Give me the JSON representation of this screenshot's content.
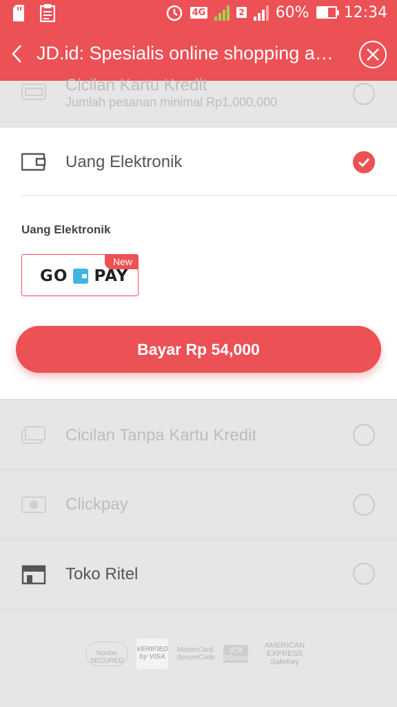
{
  "status_bar": {
    "network": "4G",
    "sim_slot": "2",
    "battery_percent": "60%",
    "battery_level": 0.6,
    "time": "12:34",
    "icons": [
      "sd-card-icon",
      "clipboard-icon",
      "alarm-icon",
      "signal-icon",
      "battery-icon"
    ]
  },
  "app_bar": {
    "title": "JD.id: Spesialis online shopping a…",
    "back_icon": "back-arrow-icon",
    "close_icon": "close-icon"
  },
  "colors": {
    "accent": "#ec5156",
    "gopay_blue": "#3fb5e3"
  },
  "payment_methods": [
    {
      "label": "Cicilan Kartu Kredit",
      "sub": "Jumlah pesanan minimal Rp1,000,000",
      "icon": "credit-card-icon",
      "enabled": false,
      "selected": false
    },
    {
      "label": "Uang Elektronik",
      "icon": "wallet-icon",
      "enabled": true,
      "selected": true
    },
    {
      "label": "Cicilan Tanpa Kartu Kredit",
      "icon": "cards-icon",
      "enabled": false,
      "selected": false
    },
    {
      "label": "Clickpay",
      "icon": "clickpay-icon",
      "enabled": false,
      "selected": false
    },
    {
      "label": "Toko Ritel",
      "icon": "store-icon",
      "enabled": true,
      "selected": false
    }
  ],
  "ewallet": {
    "section_title": "Uang Elektronik",
    "option_left": "GO",
    "option_right": "PAY",
    "badge": "New"
  },
  "pay_button": "Bayar Rp 54,000",
  "security_badges": [
    "Norton SECURED",
    "VERIFIED by VISA",
    "MasterCard. SecureCode",
    "JCB J/Secure",
    "AMERICAN EXPRESS SafeKey"
  ]
}
